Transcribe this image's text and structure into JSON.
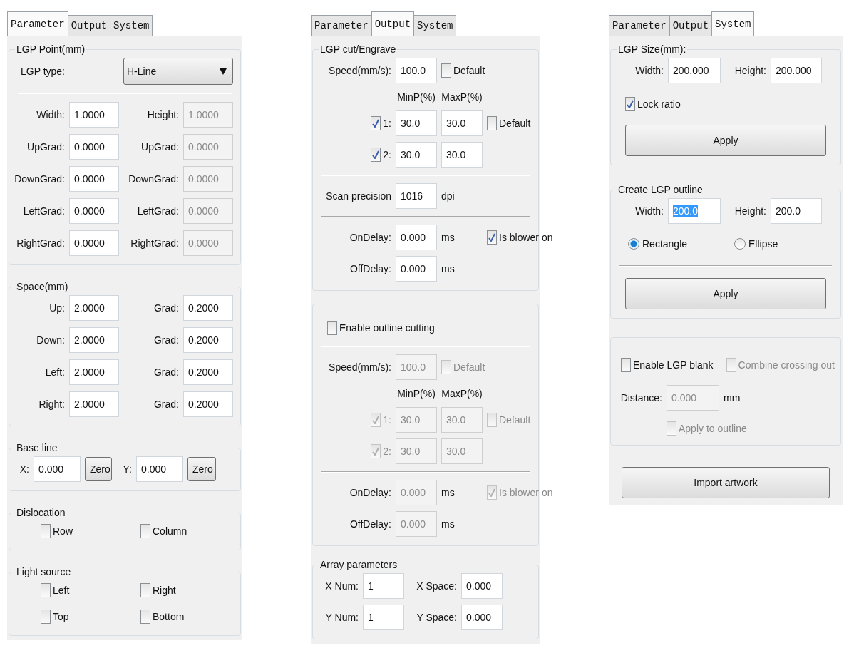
{
  "panels": [
    {
      "tabs": [
        {
          "label": "Parameter",
          "selected": true
        },
        {
          "label": "Output",
          "selected": false
        },
        {
          "label": "System",
          "selected": false
        }
      ],
      "groups": [
        {
          "title": "LGP Point(mm)",
          "rows": [
            {
              "kind": "line",
              "items": [
                {
                  "kind": "label",
                  "text": "LGP type:"
                },
                {
                  "kind": "select",
                  "value": "H-Line"
                }
              ]
            },
            {
              "kind": "divider"
            },
            {
              "kind": "line",
              "items": [
                {
                  "kind": "label",
                  "text": "Width:"
                },
                {
                  "kind": "field",
                  "value": "1.0000",
                  "disabled": false
                },
                {
                  "kind": "label",
                  "text": "Height:"
                },
                {
                  "kind": "field",
                  "value": "1.0000",
                  "disabled": true
                }
              ]
            },
            {
              "kind": "line",
              "items": [
                {
                  "kind": "label",
                  "text": "UpGrad:"
                },
                {
                  "kind": "field",
                  "value": "0.0000",
                  "disabled": false
                },
                {
                  "kind": "label",
                  "text": "UpGrad:"
                },
                {
                  "kind": "field",
                  "value": "0.0000",
                  "disabled": true
                }
              ]
            },
            {
              "kind": "line",
              "items": [
                {
                  "kind": "label",
                  "text": "DownGrad:"
                },
                {
                  "kind": "field",
                  "value": "0.0000",
                  "disabled": false
                },
                {
                  "kind": "label",
                  "text": "DownGrad:"
                },
                {
                  "kind": "field",
                  "value": "0.0000",
                  "disabled": true
                }
              ]
            },
            {
              "kind": "line",
              "items": [
                {
                  "kind": "label",
                  "text": "LeftGrad:"
                },
                {
                  "kind": "field",
                  "value": "0.0000",
                  "disabled": false
                },
                {
                  "kind": "label",
                  "text": "LeftGrad:"
                },
                {
                  "kind": "field",
                  "value": "0.0000",
                  "disabled": true
                }
              ]
            },
            {
              "kind": "line",
              "items": [
                {
                  "kind": "label",
                  "text": "RightGrad:"
                },
                {
                  "kind": "field",
                  "value": "0.0000",
                  "disabled": false
                },
                {
                  "kind": "label",
                  "text": "RightGrad:"
                },
                {
                  "kind": "field",
                  "value": "0.0000",
                  "disabled": true
                }
              ]
            }
          ]
        },
        {
          "title": "Space(mm)",
          "rows": [
            {
              "kind": "line",
              "items": [
                {
                  "kind": "label",
                  "text": "Up:"
                },
                {
                  "kind": "field",
                  "value": "2.0000",
                  "disabled": false
                },
                {
                  "kind": "label",
                  "text": "Grad:"
                },
                {
                  "kind": "field",
                  "value": "0.2000",
                  "disabled": false
                }
              ]
            },
            {
              "kind": "line",
              "items": [
                {
                  "kind": "label",
                  "text": "Down:"
                },
                {
                  "kind": "field",
                  "value": "2.0000",
                  "disabled": false
                },
                {
                  "kind": "label",
                  "text": "Grad:"
                },
                {
                  "kind": "field",
                  "value": "0.2000",
                  "disabled": false
                }
              ]
            },
            {
              "kind": "line",
              "items": [
                {
                  "kind": "label",
                  "text": "Left:"
                },
                {
                  "kind": "field",
                  "value": "2.0000",
                  "disabled": false
                },
                {
                  "kind": "label",
                  "text": "Grad:"
                },
                {
                  "kind": "field",
                  "value": "0.2000",
                  "disabled": false
                }
              ]
            },
            {
              "kind": "line",
              "items": [
                {
                  "kind": "label",
                  "text": "Right:"
                },
                {
                  "kind": "field",
                  "value": "2.0000",
                  "disabled": false
                },
                {
                  "kind": "label",
                  "text": "Grad:"
                },
                {
                  "kind": "field",
                  "value": "0.2000",
                  "disabled": false
                }
              ]
            }
          ]
        },
        {
          "title": "Base line",
          "rows": [
            {
              "kind": "line",
              "items": [
                {
                  "kind": "label",
                  "text": "X:"
                },
                {
                  "kind": "field",
                  "value": "0.000",
                  "disabled": false
                },
                {
                  "kind": "button",
                  "text": "Zero"
                },
                {
                  "kind": "label",
                  "text": "Y:"
                },
                {
                  "kind": "field",
                  "value": "0.000",
                  "disabled": false
                },
                {
                  "kind": "button",
                  "text": "Zero"
                }
              ]
            }
          ]
        },
        {
          "title": "Dislocation",
          "rows": [
            {
              "kind": "pair",
              "items": [
                {
                  "kind": "check",
                  "text": "Row",
                  "checked": false,
                  "disabled": false
                },
                {
                  "kind": "check",
                  "text": "Column",
                  "checked": false,
                  "disabled": false
                }
              ]
            }
          ]
        },
        {
          "title": "Light source",
          "rows": [
            {
              "kind": "pair",
              "items": [
                {
                  "kind": "check",
                  "text": "Left",
                  "checked": false,
                  "disabled": false
                },
                {
                  "kind": "check",
                  "text": "Right",
                  "checked": false,
                  "disabled": false
                }
              ]
            },
            {
              "kind": "pair",
              "items": [
                {
                  "kind": "check",
                  "text": "Top",
                  "checked": false,
                  "disabled": false
                },
                {
                  "kind": "check",
                  "text": "Bottom",
                  "checked": false,
                  "disabled": false
                }
              ]
            }
          ]
        }
      ]
    },
    {
      "tabs": [
        {
          "label": "Parameter",
          "selected": false
        },
        {
          "label": "Output",
          "selected": true
        },
        {
          "label": "System",
          "selected": false
        }
      ],
      "groups": [
        {
          "title": "LGP cut/Engrave",
          "rows": [
            {
              "kind": "line",
              "items": [
                {
                  "kind": "label",
                  "text": "Speed(mm/s):"
                },
                {
                  "kind": "field",
                  "value": "100.0",
                  "disabled": false
                },
                {
                  "kind": "check",
                  "text": "Default",
                  "checked": false,
                  "disabled": false
                }
              ]
            },
            {
              "kind": "offset",
              "items": [
                {
                  "kind": "heading",
                  "text": "MinP(%)"
                },
                {
                  "kind": "heading",
                  "text": "MaxP(%)"
                }
              ]
            },
            {
              "kind": "line",
              "items": [
                {
                  "kind": "check",
                  "text": "1:",
                  "checked": true,
                  "disabled": false
                },
                {
                  "kind": "field",
                  "value": "30.0",
                  "disabled": false
                },
                {
                  "kind": "field",
                  "value": "30.0",
                  "disabled": false
                },
                {
                  "kind": "check",
                  "text": "Default",
                  "checked": false,
                  "disabled": false
                }
              ]
            },
            {
              "kind": "line",
              "items": [
                {
                  "kind": "check",
                  "text": "2:",
                  "checked": true,
                  "disabled": false
                },
                {
                  "kind": "field",
                  "value": "30.0",
                  "disabled": false
                },
                {
                  "kind": "field",
                  "value": "30.0",
                  "disabled": false
                }
              ]
            },
            {
              "kind": "divider"
            },
            {
              "kind": "line",
              "items": [
                {
                  "kind": "label",
                  "text": "Scan precision"
                },
                {
                  "kind": "field",
                  "value": "1016",
                  "disabled": false
                },
                {
                  "kind": "unit",
                  "text": "dpi"
                }
              ]
            },
            {
              "kind": "divider"
            },
            {
              "kind": "line",
              "items": [
                {
                  "kind": "label",
                  "text": "OnDelay:"
                },
                {
                  "kind": "field",
                  "value": "0.000",
                  "disabled": false
                },
                {
                  "kind": "unit",
                  "text": "ms"
                },
                {
                  "kind": "check",
                  "text": "Is blower on",
                  "checked": true,
                  "disabled": false
                }
              ]
            },
            {
              "kind": "line",
              "items": [
                {
                  "kind": "label",
                  "text": "OffDelay:"
                },
                {
                  "kind": "field",
                  "value": "0.000",
                  "disabled": false
                },
                {
                  "kind": "unit",
                  "text": "ms"
                }
              ]
            }
          ]
        },
        {
          "rows": [
            {
              "kind": "full",
              "items": [
                {
                  "kind": "check",
                  "text": "Enable outline cutting",
                  "checked": false,
                  "disabled": false
                }
              ]
            },
            {
              "kind": "divider"
            },
            {
              "kind": "line",
              "items": [
                {
                  "kind": "label",
                  "text": "Speed(mm/s):"
                },
                {
                  "kind": "field",
                  "value": "100.0",
                  "disabled": true
                },
                {
                  "kind": "check",
                  "text": "Default",
                  "checked": false,
                  "disabled": true
                }
              ]
            },
            {
              "kind": "offset",
              "items": [
                {
                  "kind": "heading",
                  "text": "MinP(%)"
                },
                {
                  "kind": "heading",
                  "text": "MaxP(%)"
                }
              ]
            },
            {
              "kind": "line",
              "items": [
                {
                  "kind": "check",
                  "text": "1:",
                  "checked": true,
                  "disabled": true
                },
                {
                  "kind": "field",
                  "value": "30.0",
                  "disabled": true
                },
                {
                  "kind": "field",
                  "value": "30.0",
                  "disabled": true
                },
                {
                  "kind": "check",
                  "text": "Default",
                  "checked": false,
                  "disabled": true
                }
              ]
            },
            {
              "kind": "line",
              "items": [
                {
                  "kind": "check",
                  "text": "2:",
                  "checked": true,
                  "disabled": true
                },
                {
                  "kind": "field",
                  "value": "30.0",
                  "disabled": true
                },
                {
                  "kind": "field",
                  "value": "30.0",
                  "disabled": true
                }
              ]
            },
            {
              "kind": "divider"
            },
            {
              "kind": "line",
              "items": [
                {
                  "kind": "label",
                  "text": "OnDelay:"
                },
                {
                  "kind": "field",
                  "value": "0.000",
                  "disabled": true
                },
                {
                  "kind": "unit",
                  "text": "ms"
                },
                {
                  "kind": "check",
                  "text": "Is blower on",
                  "checked": true,
                  "disabled": true
                }
              ]
            },
            {
              "kind": "line",
              "items": [
                {
                  "kind": "label",
                  "text": "OffDelay:"
                },
                {
                  "kind": "field",
                  "value": "0.000",
                  "disabled": true
                },
                {
                  "kind": "unit",
                  "text": "ms"
                }
              ]
            }
          ]
        },
        {
          "title": "Array parameters",
          "rows": [
            {
              "kind": "line",
              "items": [
                {
                  "kind": "label",
                  "text": "X Num:"
                },
                {
                  "kind": "field",
                  "value": "1",
                  "disabled": false
                },
                {
                  "kind": "label",
                  "text": "X Space:"
                },
                {
                  "kind": "field",
                  "value": "0.000",
                  "disabled": false
                }
              ]
            },
            {
              "kind": "line",
              "items": [
                {
                  "kind": "label",
                  "text": "Y Num:"
                },
                {
                  "kind": "field",
                  "value": "1",
                  "disabled": false
                },
                {
                  "kind": "label",
                  "text": "Y Space:"
                },
                {
                  "kind": "field",
                  "value": "0.000",
                  "disabled": false
                }
              ]
            }
          ]
        }
      ]
    },
    {
      "tabs": [
        {
          "label": "Parameter",
          "selected": false
        },
        {
          "label": "Output",
          "selected": false
        },
        {
          "label": "System",
          "selected": true
        }
      ],
      "groups": [
        {
          "title": "LGP Size(mm):",
          "rows": [
            {
              "kind": "line",
              "items": [
                {
                  "kind": "label",
                  "text": "Width:"
                },
                {
                  "kind": "field",
                  "value": "200.000",
                  "disabled": false
                },
                {
                  "kind": "label",
                  "text": "Height:"
                },
                {
                  "kind": "field",
                  "value": "200.000",
                  "disabled": false
                }
              ]
            },
            {
              "kind": "full",
              "items": [
                {
                  "kind": "check",
                  "text": "Lock ratio",
                  "checked": true,
                  "disabled": false
                }
              ]
            },
            {
              "kind": "full",
              "items": [
                {
                  "kind": "wide_button",
                  "text": "Apply"
                }
              ]
            }
          ]
        },
        {
          "title": "Create LGP outline",
          "rows": [
            {
              "kind": "line",
              "items": [
                {
                  "kind": "label",
                  "text": "Width:"
                },
                {
                  "kind": "field",
                  "value": "200.0",
                  "disabled": false,
                  "highlighted": true
                },
                {
                  "kind": "label",
                  "text": "Height:"
                },
                {
                  "kind": "field",
                  "value": "200.0",
                  "disabled": false,
                  "highlighted": false
                }
              ]
            },
            {
              "kind": "pair",
              "items": [
                {
                  "kind": "radio",
                  "text": "Rectangle",
                  "selected": true
                },
                {
                  "kind": "radio",
                  "text": "Ellipse",
                  "selected": false
                }
              ]
            },
            {
              "kind": "divider"
            },
            {
              "kind": "full",
              "items": [
                {
                  "kind": "wide_button",
                  "text": "Apply"
                }
              ]
            }
          ]
        },
        {
          "rows": [
            {
              "kind": "pair",
              "items": [
                {
                  "kind": "check",
                  "text": "Enable LGP blank",
                  "checked": false,
                  "disabled": false
                },
                {
                  "kind": "check",
                  "text": "Combine crossing out",
                  "checked": false,
                  "disabled": true
                }
              ]
            },
            {
              "kind": "line",
              "items": [
                {
                  "kind": "label",
                  "text": "Distance:"
                },
                {
                  "kind": "field",
                  "value": "0.000",
                  "disabled": true
                },
                {
                  "kind": "unit",
                  "text": "mm"
                }
              ]
            },
            {
              "kind": "offset",
              "items": [
                {
                  "kind": "check",
                  "text": "Apply to outline",
                  "checked": false,
                  "disabled": true
                }
              ]
            }
          ]
        }
      ],
      "footer_button": "Import artwork"
    }
  ]
}
